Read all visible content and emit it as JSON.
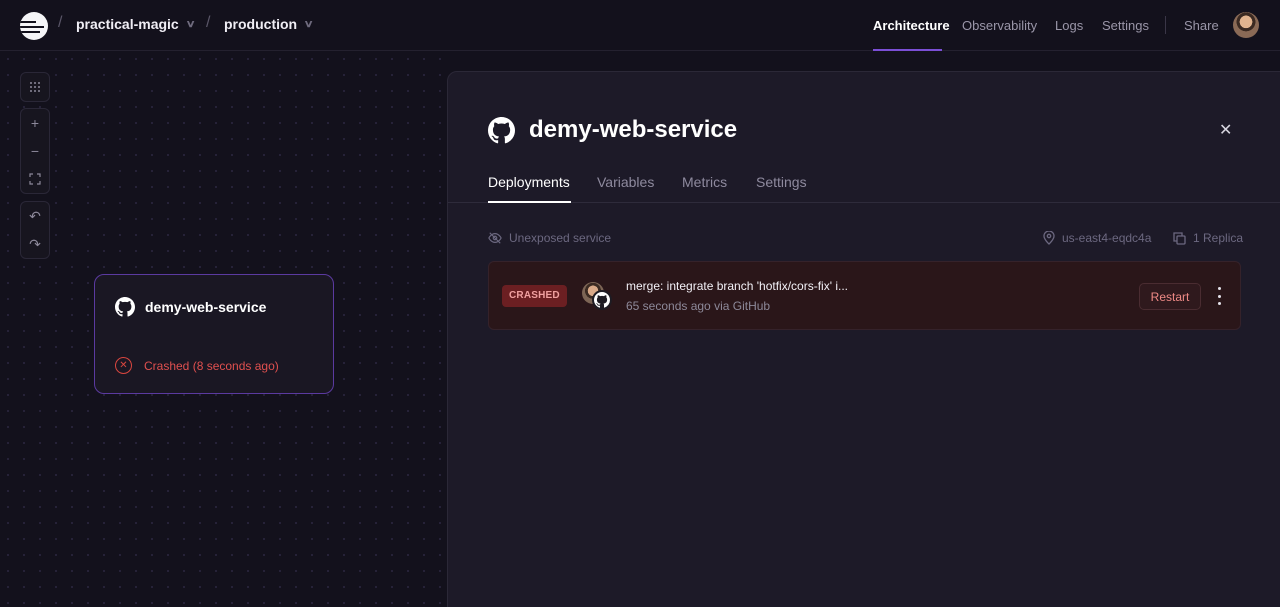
{
  "breadcrumb": {
    "project": "practical-magic",
    "environment": "production"
  },
  "nav": [
    {
      "label": "Architecture",
      "active": true
    },
    {
      "label": "Observability",
      "active": false
    },
    {
      "label": "Logs",
      "active": false
    },
    {
      "label": "Settings",
      "active": false
    },
    {
      "label": "Share",
      "active": false
    }
  ],
  "canvas": {
    "node": {
      "name": "demy-web-service",
      "status": "Crashed (8 seconds ago)"
    }
  },
  "panel": {
    "title": "demy-web-service",
    "tabs": [
      "Deployments",
      "Variables",
      "Metrics",
      "Settings"
    ],
    "active_tab": "Deployments",
    "exposure": "Unexposed service",
    "region": "us-east4-eqdc4a",
    "replicas": "1 Replica",
    "deployment": {
      "status": "CRASHED",
      "commit_message": "merge: integrate branch 'hotfix/cors-fix' i...",
      "meta": "65 seconds ago via GitHub",
      "action": "Restart"
    }
  },
  "colors": {
    "accent": "#7b4fd6",
    "danger": "#e0504f",
    "background": "#13111c"
  }
}
